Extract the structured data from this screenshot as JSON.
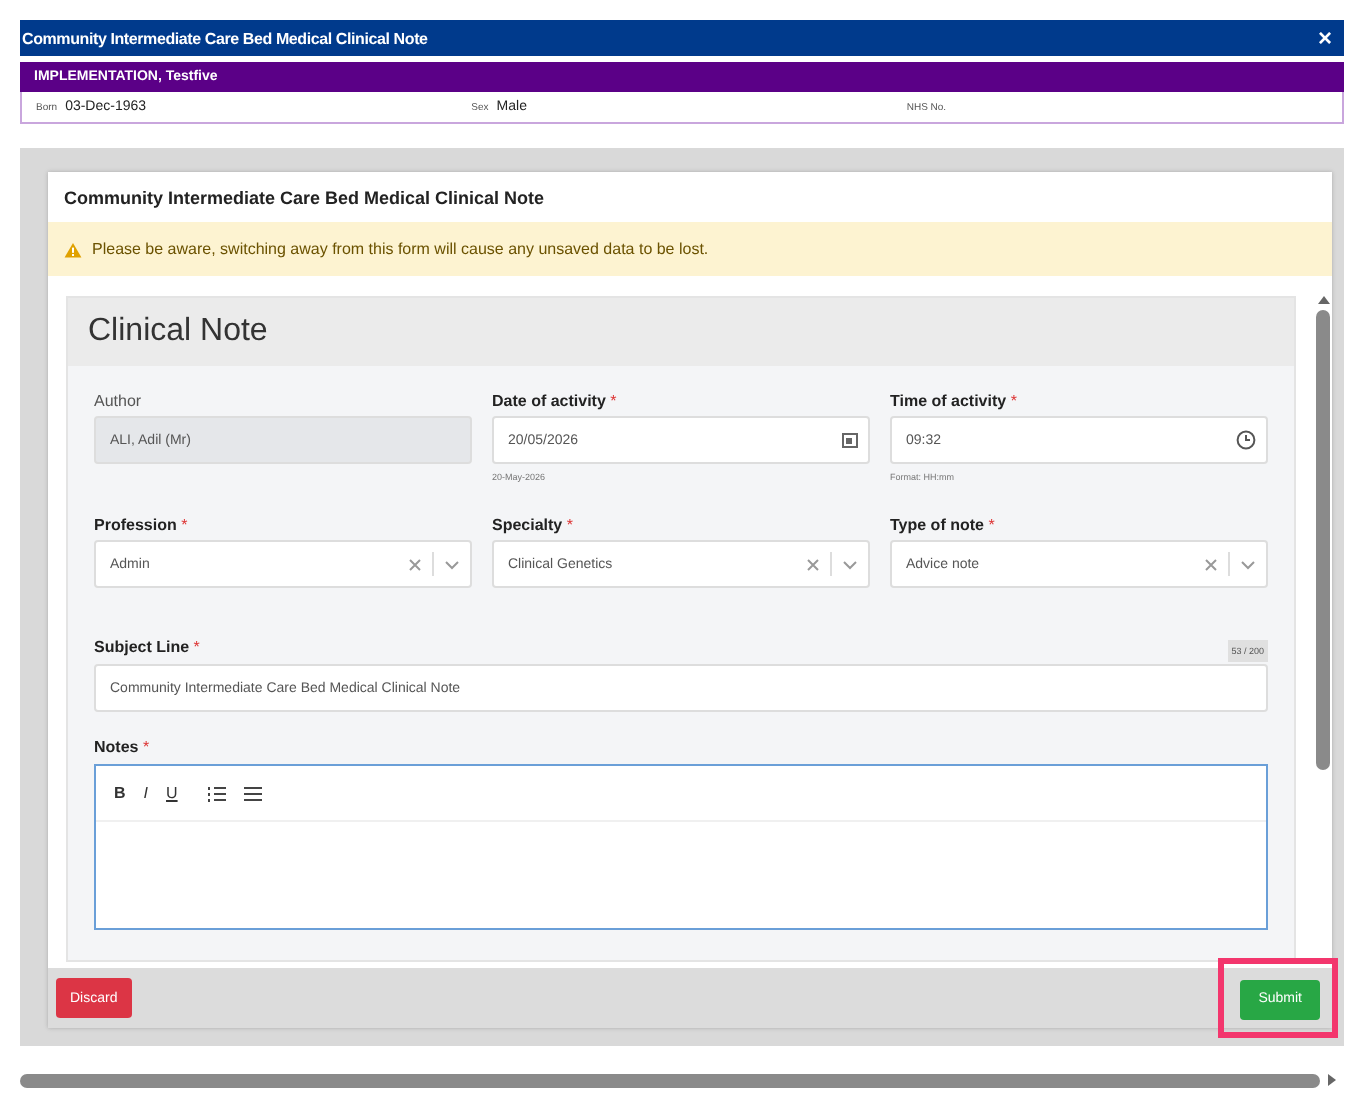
{
  "window": {
    "title": "Community Intermediate Care Bed Medical Clinical Note",
    "close": "×"
  },
  "patient": {
    "name": "IMPLEMENTATION, Testfive",
    "details": [
      {
        "label": "Born",
        "value": "03-Dec-1963"
      },
      {
        "label": "Sex",
        "value": "Male"
      },
      {
        "label": "NHS No."
      }
    ]
  },
  "form": {
    "title": "Community Intermediate Care Bed Medical Clinical Note",
    "warning": "Please be aware, switching away from this form will cause any unsaved data to be lost.",
    "card_title": "Clinical Note",
    "fields": [
      {
        "kind": "readonly",
        "label": "Author",
        "value": "ALI, Adil (Mr)"
      },
      {
        "kind": "date",
        "label": "Date of activity",
        "required_mark": "*",
        "value": "20/05/2026",
        "hint": "20-May-2026"
      },
      {
        "kind": "time",
        "label": "Time of activity",
        "required_mark": "*",
        "value": "09:32",
        "hint": "Format: HH:mm"
      },
      {
        "kind": "select",
        "label": "Profession",
        "required_mark": "*",
        "value": "Admin"
      },
      {
        "kind": "select",
        "label": "Specialty",
        "required_mark": "*",
        "value": "Clinical Genetics"
      },
      {
        "kind": "select",
        "label": "Type of note",
        "required_mark": "*",
        "value": "Advice note"
      }
    ],
    "subject": {
      "label": "Subject Line",
      "required_mark": "*",
      "value": "Community Intermediate Care Bed Medical Clinical Note",
      "counter": "53 / 200"
    },
    "notes": {
      "label": "Notes",
      "required_mark": "*",
      "format_buttons": [
        "B",
        "I",
        "U"
      ]
    }
  },
  "buttons": [
    {
      "kind": "danger",
      "label": "Discard",
      "highlighted": false
    },
    {
      "kind": "success",
      "label": "Submit",
      "highlighted": true
    }
  ]
}
